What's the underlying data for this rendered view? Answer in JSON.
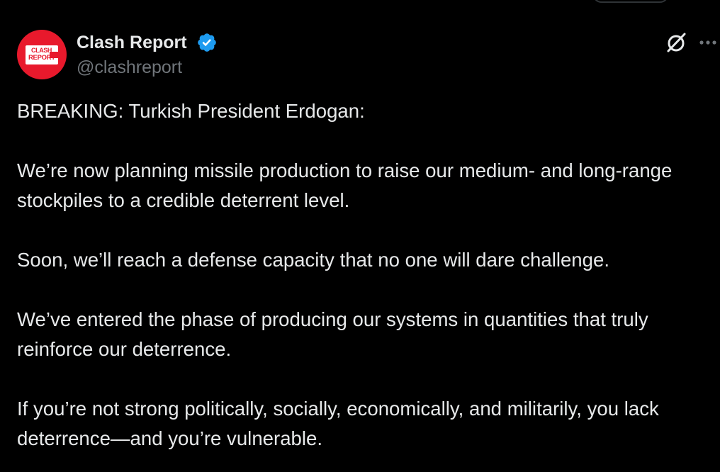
{
  "author": {
    "display_name": "Clash Report",
    "handle": "@clashreport",
    "verified": true,
    "avatar": {
      "text_line1": "CLASH",
      "text_line2": "REPORT",
      "background_color": "#e8192c"
    }
  },
  "actions": {
    "grok_icon": "grok-slash-circle-icon",
    "more_icon": "more-dots-icon"
  },
  "tweet": {
    "paragraphs": [
      "BREAKING: Turkish President Erdogan:",
      "We’re now planning missile production to raise our medium- and long-range stockpiles to a credible deterrent level.",
      "Soon, we’ll reach a defense capacity that no one will dare challenge.",
      "We’ve entered the phase of producing our systems in quantities that truly reinforce our deterrence.",
      "If you’re not strong politically, socially, economically, and militarily, you lack deterrence—and you’re vulnerable."
    ]
  },
  "colors": {
    "background": "#000000",
    "text_primary": "#e7e9ea",
    "text_secondary": "#71767b",
    "verified_blue": "#1d9bf0"
  }
}
